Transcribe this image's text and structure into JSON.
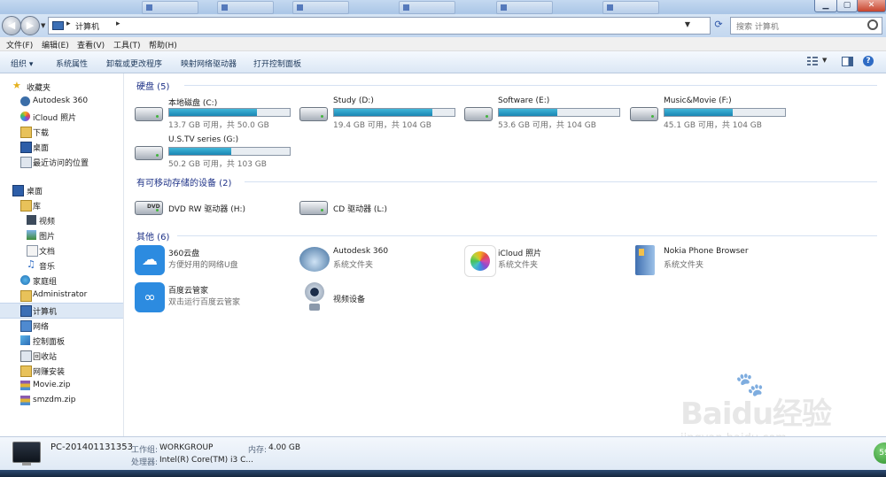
{
  "window": {
    "title_tabs_count": 6,
    "controls": {
      "minimize": "▁",
      "maximize": "▢",
      "close": "✕"
    }
  },
  "address": {
    "path": "计算机",
    "search_placeholder": "搜索 计算机"
  },
  "menu": [
    "文件(F)",
    "编辑(E)",
    "查看(V)",
    "工具(T)",
    "帮助(H)"
  ],
  "toolbar": {
    "organize": "组织 ▾",
    "system_properties": "系统属性",
    "uninstall": "卸载或更改程序",
    "map_drive": "映射网络驱动器",
    "control_panel": "打开控制面板"
  },
  "sidebar": {
    "favorites": {
      "label": "收藏夹",
      "items": [
        "Autodesk 360",
        "iCloud 照片",
        "下载",
        "桌面",
        "最近访问的位置"
      ]
    },
    "desktop": "桌面",
    "library": {
      "label": "库",
      "items": [
        "视频",
        "图片",
        "文档",
        "音乐"
      ]
    },
    "others": [
      "家庭组",
      "Administrator",
      "计算机",
      "网络",
      "控制面板",
      "回收站",
      "网赚安装",
      "Movie.zip",
      "smzdm.zip"
    ]
  },
  "groups": {
    "hard_disks": "硬盘 (5)",
    "removable": "有可移动存储的设备 (2)",
    "other": "其他 (6)"
  },
  "drives": [
    {
      "name": "本地磁盘 (C:)",
      "info": "13.7 GB 可用，共 50.0 GB",
      "used_fraction": 0.726
    },
    {
      "name": "Study (D:)",
      "info": "19.4 GB 可用，共 104 GB",
      "used_fraction": 0.813
    },
    {
      "name": "Software (E:)",
      "info": "53.6 GB 可用，共 104 GB",
      "used_fraction": 0.485
    },
    {
      "name": "Music&Movie (F:)",
      "info": "45.1 GB 可用，共 104 GB",
      "used_fraction": 0.566
    },
    {
      "name": "U.S.TV series  (G:)",
      "info": "50.2 GB 可用，共 103 GB",
      "used_fraction": 0.513
    }
  ],
  "removable": [
    {
      "name": "DVD RW 驱动器 (H:)",
      "icon_label": "DVD"
    },
    {
      "name": "CD 驱动器 (L:)"
    }
  ],
  "other_items": [
    {
      "name": "360云盘",
      "desc": "方便好用的网络U盘"
    },
    {
      "name": "Autodesk 360",
      "desc": "系统文件夹"
    },
    {
      "name": "iCloud 照片",
      "desc": "系统文件夹"
    },
    {
      "name": "Nokia Phone Browser",
      "desc": "系统文件夹"
    },
    {
      "name": "百度云管家",
      "desc": "双击运行百度云管家"
    },
    {
      "name": "视频设备",
      "desc": ""
    }
  ],
  "details": {
    "pc_name": "PC-201401131353",
    "workgroup_label": "工作组:",
    "workgroup": "WORKGROUP",
    "memory_label": "内存:",
    "memory": "4.00 GB",
    "cpu_label": "处理器:",
    "cpu": "Intel(R) Core(TM) i3 C..."
  },
  "watermark": {
    "brand": "Baidu经验",
    "url": "jingyan.baidu.com"
  },
  "taskbar_badge": "59"
}
